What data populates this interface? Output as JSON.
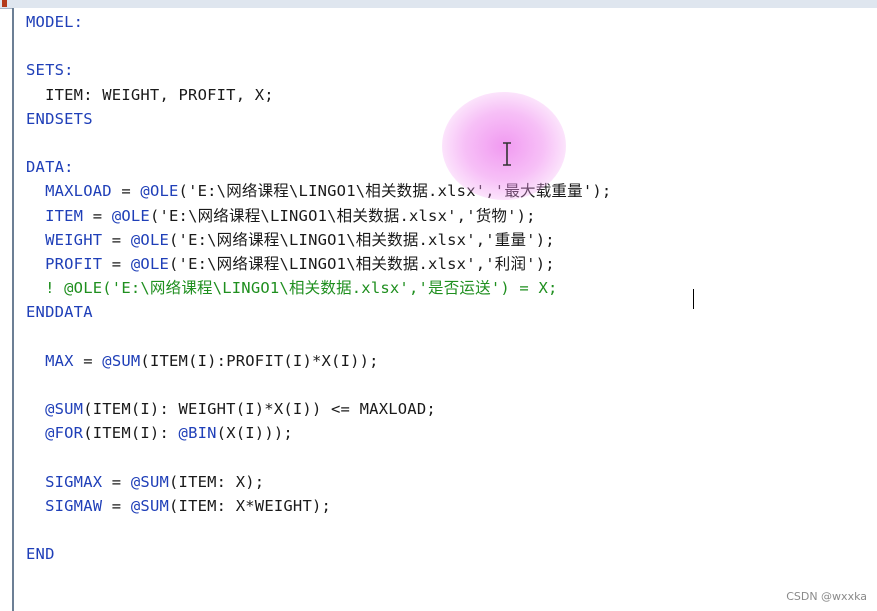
{
  "colors": {
    "keyword": "#1f3fb8",
    "comment": "#1f8f1f",
    "text": "#1a1a1a"
  },
  "lines": [
    [
      {
        "t": "MODEL:",
        "c": "kw"
      }
    ],
    [],
    [
      {
        "t": "SETS:",
        "c": "kw"
      }
    ],
    [
      {
        "t": "  ITEM: WEIGHT, PROFIT, X;",
        "c": ""
      }
    ],
    [
      {
        "t": "ENDSETS",
        "c": "kw"
      }
    ],
    [],
    [
      {
        "t": "DATA:",
        "c": "kw"
      }
    ],
    [
      {
        "t": "  MAXLOAD",
        "c": "kw"
      },
      {
        "t": " = ",
        "c": ""
      },
      {
        "t": "@OLE",
        "c": "kw"
      },
      {
        "t": "('E:\\网络课程\\LINGO1\\相关数据.xlsx','最大载重量');",
        "c": ""
      }
    ],
    [
      {
        "t": "  ITEM",
        "c": "kw"
      },
      {
        "t": " = ",
        "c": ""
      },
      {
        "t": "@OLE",
        "c": "kw"
      },
      {
        "t": "('E:\\网络课程\\LINGO1\\相关数据.xlsx','货物');",
        "c": ""
      }
    ],
    [
      {
        "t": "  WEIGHT",
        "c": "kw"
      },
      {
        "t": " = ",
        "c": ""
      },
      {
        "t": "@OLE",
        "c": "kw"
      },
      {
        "t": "('E:\\网络课程\\LINGO1\\相关数据.xlsx','重量');",
        "c": ""
      }
    ],
    [
      {
        "t": "  PROFIT",
        "c": "kw"
      },
      {
        "t": " = ",
        "c": ""
      },
      {
        "t": "@OLE",
        "c": "kw"
      },
      {
        "t": "('E:\\网络课程\\LINGO1\\相关数据.xlsx','利润');",
        "c": ""
      }
    ],
    [
      {
        "t": "  ! @OLE('E:\\网络课程\\LINGO1\\相关数据.xlsx','是否运送') = X;",
        "c": "cm"
      }
    ],
    [
      {
        "t": "ENDDATA",
        "c": "kw"
      }
    ],
    [],
    [
      {
        "t": "  MAX",
        "c": "kw"
      },
      {
        "t": " = ",
        "c": ""
      },
      {
        "t": "@SUM",
        "c": "kw"
      },
      {
        "t": "(ITEM(I):PROFIT(I)*X(I));",
        "c": ""
      }
    ],
    [],
    [
      {
        "t": "  @SUM",
        "c": "kw"
      },
      {
        "t": "(ITEM(I): WEIGHT(I)*X(I)) <= MAXLOAD;",
        "c": ""
      }
    ],
    [
      {
        "t": "  @FOR",
        "c": "kw"
      },
      {
        "t": "(ITEM(I): ",
        "c": ""
      },
      {
        "t": "@BIN",
        "c": "kw"
      },
      {
        "t": "(X(I)));",
        "c": ""
      }
    ],
    [],
    [
      {
        "t": "  SIGMAX",
        "c": "kw"
      },
      {
        "t": " = ",
        "c": ""
      },
      {
        "t": "@SUM",
        "c": "kw"
      },
      {
        "t": "(ITEM: X);",
        "c": ""
      }
    ],
    [
      {
        "t": "  SIGMAW",
        "c": "kw"
      },
      {
        "t": " = ",
        "c": ""
      },
      {
        "t": "@SUM",
        "c": "kw"
      },
      {
        "t": "(ITEM: X*WEIGHT);",
        "c": ""
      }
    ],
    [],
    [
      {
        "t": "END",
        "c": "kw"
      }
    ]
  ],
  "watermark": "CSDN @wxxka"
}
